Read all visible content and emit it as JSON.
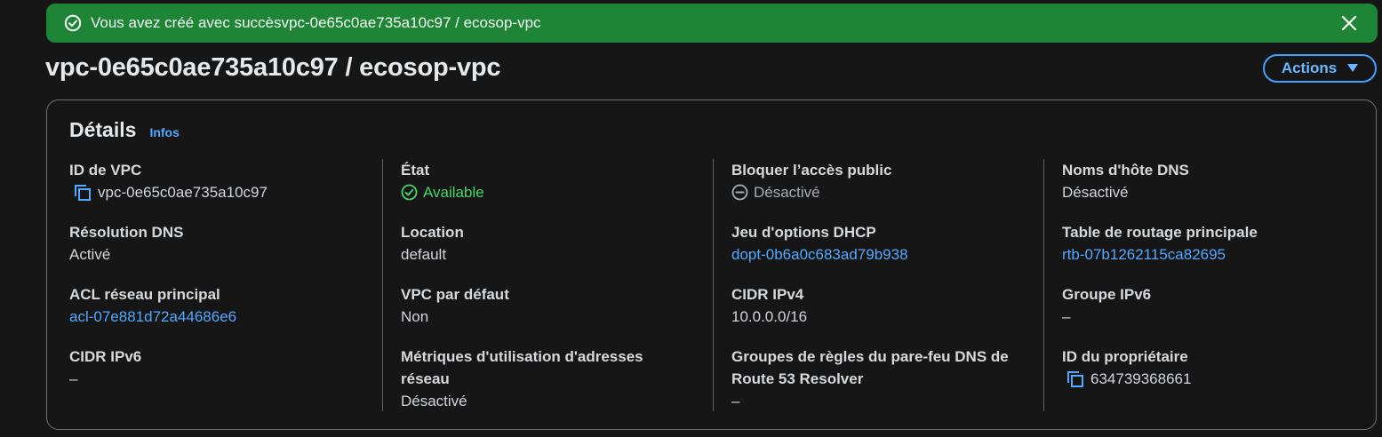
{
  "flash": {
    "message": "Vous avez créé avec succèsvpc-0e65c0ae735a10c97 / ecosop-vpc",
    "status_color": "#1e8537"
  },
  "header": {
    "title": "vpc-0e65c0ae735a10c97 / ecosop-vpc",
    "actions_label": "Actions"
  },
  "details": {
    "title": "Détails",
    "info_label": "Infos",
    "columns": [
      {
        "fields": [
          {
            "label": "ID de VPC",
            "value": "vpc-0e65c0ae735a10c97",
            "icon": "copy-icon"
          },
          {
            "label": "Résolution DNS",
            "value": "Activé"
          },
          {
            "label": "ACL réseau principal",
            "value": "acl-07e881d72a44686e6",
            "link": true
          },
          {
            "label": "CIDR IPv6",
            "value": "–"
          }
        ]
      },
      {
        "fields": [
          {
            "label": "État",
            "value": "Available",
            "icon": "check-circle-icon",
            "status_color": "#46d66a"
          },
          {
            "label": "Location",
            "value": "default"
          },
          {
            "label": "VPC par défaut",
            "value": "Non"
          },
          {
            "label": "Métriques d'utilisation d'adresses réseau",
            "value": "Désactivé"
          }
        ]
      },
      {
        "fields": [
          {
            "label": "Bloquer l’accès public",
            "value": "Désactivé",
            "icon": "minus-circle-icon"
          },
          {
            "label": "Jeu d'options DHCP",
            "value": "dopt-0b6a0c683ad79b938",
            "link": true
          },
          {
            "label": "CIDR IPv4",
            "value": "10.0.0.0/16"
          },
          {
            "label": "Groupes de règles du pare-feu DNS de Route 53 Resolver",
            "value": "–"
          }
        ]
      },
      {
        "fields": [
          {
            "label": "Noms d'hôte DNS",
            "value": "Désactivé"
          },
          {
            "label": "Table de routage principale",
            "value": "rtb-07b1262115ca82695",
            "link": true
          },
          {
            "label": "Groupe IPv6",
            "value": "–"
          },
          {
            "label": "ID du propriétaire",
            "value": "634739368661",
            "icon": "copy-icon"
          }
        ]
      }
    ]
  },
  "colors": {
    "link": "#53a8ff",
    "background": "#161616",
    "accent": "#42a2ff"
  }
}
